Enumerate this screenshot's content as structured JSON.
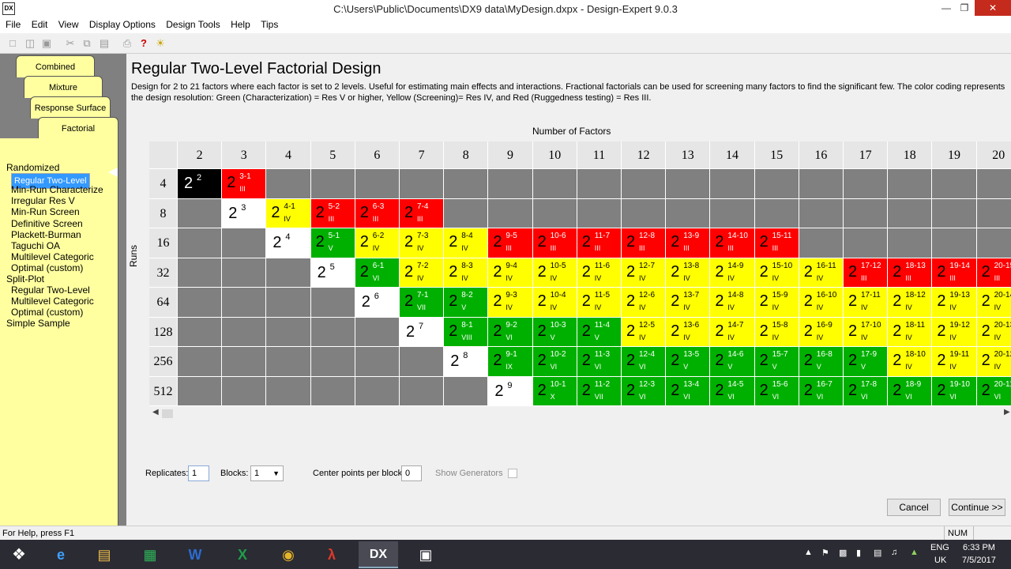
{
  "window": {
    "title": "C:\\Users\\Public\\Documents\\DX9 data\\MyDesign.dxpx - Design-Expert 9.0.3",
    "app_icon": "DX",
    "controls": [
      "minimize-icon",
      "restore-icon",
      "close-icon"
    ]
  },
  "menu": [
    "File",
    "Edit",
    "View",
    "Display Options",
    "Design Tools",
    "Help",
    "Tips"
  ],
  "toolbar_icons": [
    "new-icon",
    "open-icon",
    "save-icon",
    "cut-icon",
    "copy-icon",
    "paste-icon",
    "print-icon",
    "help-icon",
    "tip-bulb-icon"
  ],
  "tabs": [
    "Combined",
    "Mixture",
    "Response Surface",
    "Factorial"
  ],
  "tree": [
    {
      "label": "Randomized",
      "indent": 0,
      "selected": false
    },
    {
      "label": "Regular Two-Level",
      "indent": 1,
      "selected": true
    },
    {
      "label": "Min-Run Characterize",
      "indent": 1,
      "selected": false
    },
    {
      "label": "Irregular Res V",
      "indent": 1,
      "selected": false
    },
    {
      "label": "Min-Run Screen",
      "indent": 1,
      "selected": false
    },
    {
      "label": "Definitive Screen",
      "indent": 1,
      "selected": false
    },
    {
      "label": "Plackett-Burman",
      "indent": 1,
      "selected": false
    },
    {
      "label": "Taguchi OA",
      "indent": 1,
      "selected": false
    },
    {
      "label": "Multilevel Categoric",
      "indent": 1,
      "selected": false
    },
    {
      "label": "Optimal (custom)",
      "indent": 1,
      "selected": false
    },
    {
      "label": "Split-Plot",
      "indent": 0,
      "selected": false
    },
    {
      "label": "Regular Two-Level",
      "indent": 1,
      "selected": false
    },
    {
      "label": "Multilevel Categoric",
      "indent": 1,
      "selected": false
    },
    {
      "label": "Optimal (custom)",
      "indent": 1,
      "selected": false
    },
    {
      "label": "Simple Sample",
      "indent": 0,
      "selected": false
    }
  ],
  "main": {
    "heading": "Regular Two-Level Factorial Design",
    "description": "Design for 2 to 21 factors where each factor is set to 2 levels.  Useful for estimating main effects and interactions.  Fractional factorials can be used for screening many factors to find the significant few. The color coding represents the design resolution: Green (Characterization) = Res V or higher, Yellow (Screening)= Res IV, and Red (Ruggedness testing) = Res III.",
    "x_axis_title": "Number of Factors",
    "y_axis_title": "Runs",
    "factors": [
      "2",
      "3",
      "4",
      "5",
      "6",
      "7",
      "8",
      "9",
      "10",
      "11",
      "12",
      "13",
      "14",
      "15",
      "16",
      "17",
      "18",
      "19",
      "20"
    ],
    "runs": [
      "4",
      "8",
      "16",
      "32",
      "64",
      "128",
      "256",
      "512"
    ],
    "colors": {
      "red": "#ff0000",
      "yellow": "#ffff00",
      "green": "#00b000",
      "gray": "#808080",
      "white": "#ffffff",
      "black": "#000000"
    },
    "grid": [
      [
        {
          "c": "black",
          "b": "2",
          "e": "2",
          "r": "",
          "full": true
        },
        {
          "c": "red",
          "b": "2",
          "e": "3-1",
          "r": "III"
        },
        {
          "c": "gray"
        },
        {
          "c": "gray"
        },
        {
          "c": "gray"
        },
        {
          "c": "gray"
        },
        {
          "c": "gray"
        },
        {
          "c": "gray"
        },
        {
          "c": "gray"
        },
        {
          "c": "gray"
        },
        {
          "c": "gray"
        },
        {
          "c": "gray"
        },
        {
          "c": "gray"
        },
        {
          "c": "gray"
        },
        {
          "c": "gray"
        },
        {
          "c": "gray"
        },
        {
          "c": "gray"
        },
        {
          "c": "gray"
        },
        {
          "c": "gray"
        }
      ],
      [
        {
          "c": "gray"
        },
        {
          "c": "white",
          "b": "2",
          "e": "3",
          "r": "",
          "full": true
        },
        {
          "c": "yellow",
          "b": "2",
          "e": "4-1",
          "r": "IV"
        },
        {
          "c": "red",
          "b": "2",
          "e": "5-2",
          "r": "III"
        },
        {
          "c": "red",
          "b": "2",
          "e": "6-3",
          "r": "III"
        },
        {
          "c": "red",
          "b": "2",
          "e": "7-4",
          "r": "III"
        },
        {
          "c": "gray"
        },
        {
          "c": "gray"
        },
        {
          "c": "gray"
        },
        {
          "c": "gray"
        },
        {
          "c": "gray"
        },
        {
          "c": "gray"
        },
        {
          "c": "gray"
        },
        {
          "c": "gray"
        },
        {
          "c": "gray"
        },
        {
          "c": "gray"
        },
        {
          "c": "gray"
        },
        {
          "c": "gray"
        },
        {
          "c": "gray"
        }
      ],
      [
        {
          "c": "gray"
        },
        {
          "c": "gray"
        },
        {
          "c": "white",
          "b": "2",
          "e": "4",
          "r": "",
          "full": true
        },
        {
          "c": "green",
          "b": "2",
          "e": "5-1",
          "r": "V"
        },
        {
          "c": "yellow",
          "b": "2",
          "e": "6-2",
          "r": "IV"
        },
        {
          "c": "yellow",
          "b": "2",
          "e": "7-3",
          "r": "IV"
        },
        {
          "c": "yellow",
          "b": "2",
          "e": "8-4",
          "r": "IV"
        },
        {
          "c": "red",
          "b": "2",
          "e": "9-5",
          "r": "III"
        },
        {
          "c": "red",
          "b": "2",
          "e": "10-6",
          "r": "III"
        },
        {
          "c": "red",
          "b": "2",
          "e": "11-7",
          "r": "III"
        },
        {
          "c": "red",
          "b": "2",
          "e": "12-8",
          "r": "III"
        },
        {
          "c": "red",
          "b": "2",
          "e": "13-9",
          "r": "III"
        },
        {
          "c": "red",
          "b": "2",
          "e": "14-10",
          "r": "III"
        },
        {
          "c": "red",
          "b": "2",
          "e": "15-11",
          "r": "III"
        },
        {
          "c": "gray"
        },
        {
          "c": "gray"
        },
        {
          "c": "gray"
        },
        {
          "c": "gray"
        },
        {
          "c": "gray"
        }
      ],
      [
        {
          "c": "gray"
        },
        {
          "c": "gray"
        },
        {
          "c": "gray"
        },
        {
          "c": "white",
          "b": "2",
          "e": "5",
          "r": "",
          "full": true
        },
        {
          "c": "green",
          "b": "2",
          "e": "6-1",
          "r": "VI"
        },
        {
          "c": "yellow",
          "b": "2",
          "e": "7-2",
          "r": "IV"
        },
        {
          "c": "yellow",
          "b": "2",
          "e": "8-3",
          "r": "IV"
        },
        {
          "c": "yellow",
          "b": "2",
          "e": "9-4",
          "r": "IV"
        },
        {
          "c": "yellow",
          "b": "2",
          "e": "10-5",
          "r": "IV"
        },
        {
          "c": "yellow",
          "b": "2",
          "e": "11-6",
          "r": "IV"
        },
        {
          "c": "yellow",
          "b": "2",
          "e": "12-7",
          "r": "IV"
        },
        {
          "c": "yellow",
          "b": "2",
          "e": "13-8",
          "r": "IV"
        },
        {
          "c": "yellow",
          "b": "2",
          "e": "14-9",
          "r": "IV"
        },
        {
          "c": "yellow",
          "b": "2",
          "e": "15-10",
          "r": "IV"
        },
        {
          "c": "yellow",
          "b": "2",
          "e": "16-11",
          "r": "IV"
        },
        {
          "c": "red",
          "b": "2",
          "e": "17-12",
          "r": "III"
        },
        {
          "c": "red",
          "b": "2",
          "e": "18-13",
          "r": "III"
        },
        {
          "c": "red",
          "b": "2",
          "e": "19-14",
          "r": "III"
        },
        {
          "c": "red",
          "b": "2",
          "e": "20-15",
          "r": "III"
        }
      ],
      [
        {
          "c": "gray"
        },
        {
          "c": "gray"
        },
        {
          "c": "gray"
        },
        {
          "c": "gray"
        },
        {
          "c": "white",
          "b": "2",
          "e": "6",
          "r": "",
          "full": true
        },
        {
          "c": "green",
          "b": "2",
          "e": "7-1",
          "r": "VII"
        },
        {
          "c": "green",
          "b": "2",
          "e": "8-2",
          "r": "V"
        },
        {
          "c": "yellow",
          "b": "2",
          "e": "9-3",
          "r": "IV"
        },
        {
          "c": "yellow",
          "b": "2",
          "e": "10-4",
          "r": "IV"
        },
        {
          "c": "yellow",
          "b": "2",
          "e": "11-5",
          "r": "IV"
        },
        {
          "c": "yellow",
          "b": "2",
          "e": "12-6",
          "r": "IV"
        },
        {
          "c": "yellow",
          "b": "2",
          "e": "13-7",
          "r": "IV"
        },
        {
          "c": "yellow",
          "b": "2",
          "e": "14-8",
          "r": "IV"
        },
        {
          "c": "yellow",
          "b": "2",
          "e": "15-9",
          "r": "IV"
        },
        {
          "c": "yellow",
          "b": "2",
          "e": "16-10",
          "r": "IV"
        },
        {
          "c": "yellow",
          "b": "2",
          "e": "17-11",
          "r": "IV"
        },
        {
          "c": "yellow",
          "b": "2",
          "e": "18-12",
          "r": "IV"
        },
        {
          "c": "yellow",
          "b": "2",
          "e": "19-13",
          "r": "IV"
        },
        {
          "c": "yellow",
          "b": "2",
          "e": "20-14",
          "r": "IV"
        }
      ],
      [
        {
          "c": "gray"
        },
        {
          "c": "gray"
        },
        {
          "c": "gray"
        },
        {
          "c": "gray"
        },
        {
          "c": "gray"
        },
        {
          "c": "white",
          "b": "2",
          "e": "7",
          "r": "",
          "full": true
        },
        {
          "c": "green",
          "b": "2",
          "e": "8-1",
          "r": "VIII"
        },
        {
          "c": "green",
          "b": "2",
          "e": "9-2",
          "r": "VI"
        },
        {
          "c": "green",
          "b": "2",
          "e": "10-3",
          "r": "V"
        },
        {
          "c": "green",
          "b": "2",
          "e": "11-4",
          "r": "V"
        },
        {
          "c": "yellow",
          "b": "2",
          "e": "12-5",
          "r": "IV"
        },
        {
          "c": "yellow",
          "b": "2",
          "e": "13-6",
          "r": "IV"
        },
        {
          "c": "yellow",
          "b": "2",
          "e": "14-7",
          "r": "IV"
        },
        {
          "c": "yellow",
          "b": "2",
          "e": "15-8",
          "r": "IV"
        },
        {
          "c": "yellow",
          "b": "2",
          "e": "16-9",
          "r": "IV"
        },
        {
          "c": "yellow",
          "b": "2",
          "e": "17-10",
          "r": "IV"
        },
        {
          "c": "yellow",
          "b": "2",
          "e": "18-11",
          "r": "IV"
        },
        {
          "c": "yellow",
          "b": "2",
          "e": "19-12",
          "r": "IV"
        },
        {
          "c": "yellow",
          "b": "2",
          "e": "20-13",
          "r": "IV"
        }
      ],
      [
        {
          "c": "gray"
        },
        {
          "c": "gray"
        },
        {
          "c": "gray"
        },
        {
          "c": "gray"
        },
        {
          "c": "gray"
        },
        {
          "c": "gray"
        },
        {
          "c": "white",
          "b": "2",
          "e": "8",
          "r": "",
          "full": true
        },
        {
          "c": "green",
          "b": "2",
          "e": "9-1",
          "r": "IX"
        },
        {
          "c": "green",
          "b": "2",
          "e": "10-2",
          "r": "VI"
        },
        {
          "c": "green",
          "b": "2",
          "e": "11-3",
          "r": "VI"
        },
        {
          "c": "green",
          "b": "2",
          "e": "12-4",
          "r": "VI"
        },
        {
          "c": "green",
          "b": "2",
          "e": "13-5",
          "r": "V"
        },
        {
          "c": "green",
          "b": "2",
          "e": "14-6",
          "r": "V"
        },
        {
          "c": "green",
          "b": "2",
          "e": "15-7",
          "r": "V"
        },
        {
          "c": "green",
          "b": "2",
          "e": "16-8",
          "r": "V"
        },
        {
          "c": "green",
          "b": "2",
          "e": "17-9",
          "r": "V"
        },
        {
          "c": "yellow",
          "b": "2",
          "e": "18-10",
          "r": "IV"
        },
        {
          "c": "yellow",
          "b": "2",
          "e": "19-11",
          "r": "IV"
        },
        {
          "c": "yellow",
          "b": "2",
          "e": "20-12",
          "r": "IV"
        }
      ],
      [
        {
          "c": "gray"
        },
        {
          "c": "gray"
        },
        {
          "c": "gray"
        },
        {
          "c": "gray"
        },
        {
          "c": "gray"
        },
        {
          "c": "gray"
        },
        {
          "c": "gray"
        },
        {
          "c": "white",
          "b": "2",
          "e": "9",
          "r": "",
          "full": true
        },
        {
          "c": "green",
          "b": "2",
          "e": "10-1",
          "r": "X"
        },
        {
          "c": "green",
          "b": "2",
          "e": "11-2",
          "r": "VII"
        },
        {
          "c": "green",
          "b": "2",
          "e": "12-3",
          "r": "VI"
        },
        {
          "c": "green",
          "b": "2",
          "e": "13-4",
          "r": "VI"
        },
        {
          "c": "green",
          "b": "2",
          "e": "14-5",
          "r": "VI"
        },
        {
          "c": "green",
          "b": "2",
          "e": "15-6",
          "r": "VI"
        },
        {
          "c": "green",
          "b": "2",
          "e": "16-7",
          "r": "VI"
        },
        {
          "c": "green",
          "b": "2",
          "e": "17-8",
          "r": "VI"
        },
        {
          "c": "green",
          "b": "2",
          "e": "18-9",
          "r": "VI"
        },
        {
          "c": "green",
          "b": "2",
          "e": "19-10",
          "r": "VI"
        },
        {
          "c": "green",
          "b": "2",
          "e": "20-11",
          "r": "VI"
        }
      ]
    ]
  },
  "options": {
    "replicates_label": "Replicates:",
    "replicates_value": "1",
    "blocks_label": "Blocks:",
    "blocks_value": "1",
    "center_points_label": "Center points per block:",
    "center_points_value": "0",
    "show_generators_label": "Show Generators"
  },
  "buttons": {
    "cancel": "Cancel",
    "continue": "Continue >>"
  },
  "status": {
    "help": "For Help, press F1",
    "num": "NUM"
  },
  "taskbar": {
    "apps": [
      "start-icon",
      "ie-icon",
      "file-explorer-icon",
      "excel-table-icon",
      "word-icon",
      "excel-icon",
      "chrome-icon",
      "acrobat-icon",
      "design-expert-icon",
      "app-window-icon"
    ],
    "lang_top": "ENG",
    "lang_bottom": "UK",
    "time": "6:33 PM",
    "date": "7/5/2017"
  }
}
